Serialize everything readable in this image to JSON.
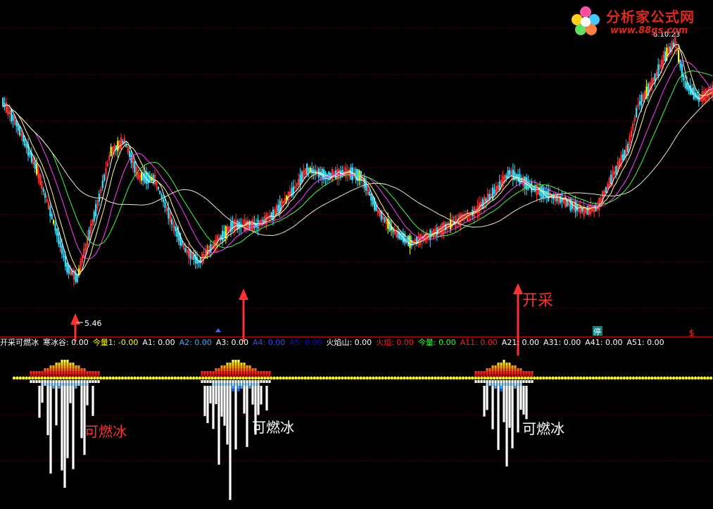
{
  "logo": {
    "title": "分析家公式网",
    "url": "www.88gs.com"
  },
  "price_label": "5.46",
  "top_right_label": "6.10.23",
  "icon_stop": "停",
  "icon_dollar": "$",
  "status": {
    "formula_name": "开采可燃冰",
    "items": [
      {
        "label": "寒冰谷:",
        "value": "0.00",
        "color": "#ffffff"
      },
      {
        "label": "今量1:",
        "value": "-0.00",
        "color": "#ffff00"
      },
      {
        "label": "A1:",
        "value": "0.00",
        "color": "#ffffff"
      },
      {
        "label": "A2:",
        "value": "0.00",
        "color": "#30b0ff"
      },
      {
        "label": "A3:",
        "value": "0.00",
        "color": "#ffffff"
      },
      {
        "label": "A4:",
        "value": "0.00",
        "color": "#3050ff"
      },
      {
        "label": "A5:",
        "value": "0.00",
        "color": "#1010c0"
      },
      {
        "label": "火焰山:",
        "value": "0.00",
        "color": "#ffffff"
      },
      {
        "label": "火焰:",
        "value": "0.00",
        "color": "#ff2020"
      },
      {
        "label": "今量:",
        "value": "0.00",
        "color": "#30ff30"
      },
      {
        "label": "A11:",
        "value": "0.00",
        "color": "#ff2020"
      },
      {
        "label": "A21:",
        "value": "0.00",
        "color": "#ffffff"
      },
      {
        "label": "A31:",
        "value": "0.00",
        "color": "#ffffff"
      },
      {
        "label": "A41:",
        "value": "0.00",
        "color": "#ffffff"
      },
      {
        "label": "A51:",
        "value": "0.00",
        "color": "#ffffff"
      }
    ]
  },
  "annotations": {
    "kaicai": "开采",
    "ice1": "可燃冰",
    "ice2": "可燃冰",
    "ice3": "可燃冰"
  },
  "colors": {
    "up": "#ff3030",
    "down": "#30e0ff",
    "doji": "#ffff00",
    "ma_white": "#ffffff",
    "ma_yellow": "#ffff80",
    "ma_magenta": "#ff40ff",
    "ma_green": "#40ff40",
    "ma_long": "#e8e8c8",
    "grid": "#8b0000",
    "arrow": "#ff3030"
  }
}
